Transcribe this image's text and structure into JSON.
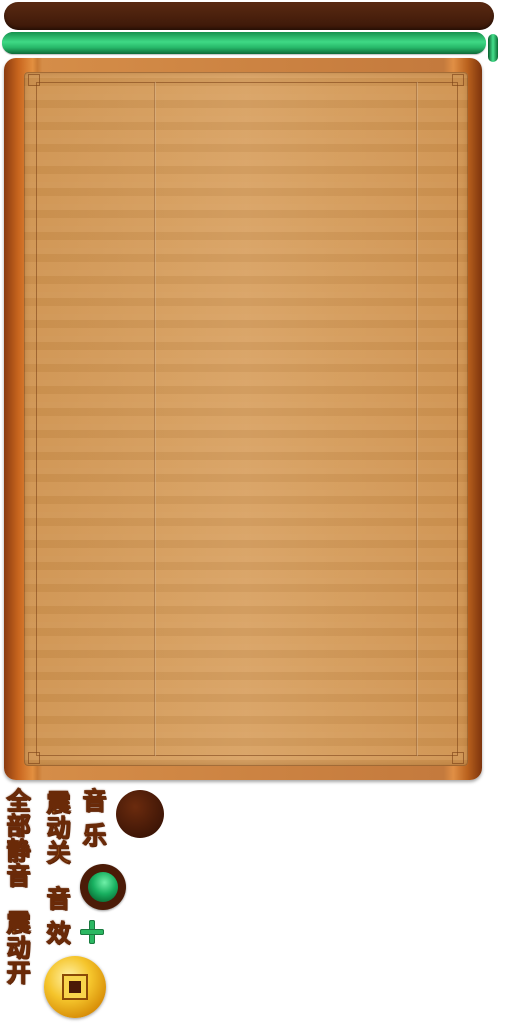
{
  "labels": {
    "music": "音 乐",
    "vibrate_off": "震动关",
    "sound_effects": "音 效",
    "mute_all": "全部静音",
    "vibrate_on": "震动开"
  },
  "progress": {
    "value_percent": 100
  },
  "colors": {
    "label_fill": "#f3b23a",
    "label_stroke": "#6a2a08",
    "progress_green": "#14a15a",
    "top_bar_brown": "#3b1708"
  },
  "icons": {
    "plus": "plus-icon",
    "coin": "coin-icon"
  }
}
